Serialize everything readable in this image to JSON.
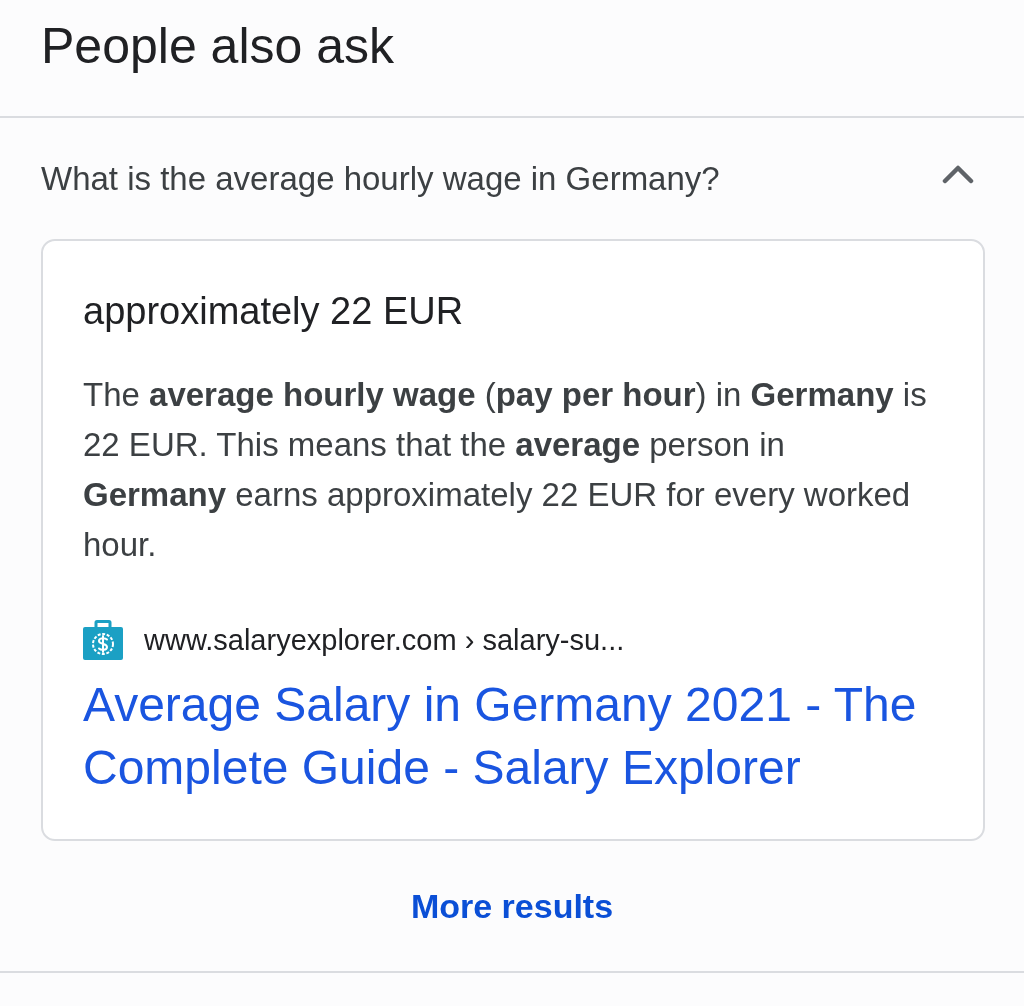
{
  "heading": "People also ask",
  "questions": [
    {
      "text": "What is the average hourly wage in Germany?",
      "expanded": true,
      "answer": {
        "title": "approximately 22 EUR",
        "snippet": "The **average hourly wage** (**pay per hour**) in **Germany** is 22 EUR. This means that the **average** person in **Germany** earns approximately 22 EUR for every worked hour.",
        "source": {
          "url": "www.salaryexplorer.com › salary-su...",
          "title": "Average Salary in Germany 2021 - The Complete Guide - Salary Explorer"
        }
      }
    }
  ],
  "more_button": "More results"
}
